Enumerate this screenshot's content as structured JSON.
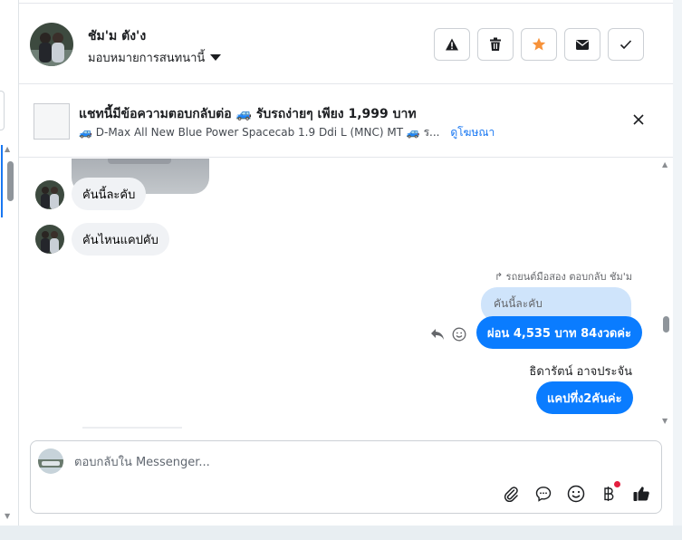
{
  "header": {
    "contact_name": "ชัม'ม ตัง'ง",
    "assign_label": "มอบหมายการสนทนานี้",
    "actions": [
      "spam-icon",
      "delete-icon",
      "star-icon",
      "mail-icon",
      "check-icon"
    ],
    "star_color": "#f7923a"
  },
  "ad": {
    "title": "แชทนี้มีข้อความตอบกลับต่อ 🚙 รับรถง่ายๆ เพียง 1,999 บาท",
    "subtitle": "🚙 D-Max All New Blue Power Spacecab 1.9 Ddi L (MNC) MT 🚙 ร...",
    "link": "ดูโฆษณา"
  },
  "messages": {
    "in_1": "คันนี้ละคับ",
    "in_2": "คันไหนแคปคับ",
    "reply_meta": "↱ รถยนต์มือสอง ตอบกลับ ชัม'ม",
    "quoted": "คันนี้ละคับ",
    "out_1": "ผ่อน 4,535 บาท 84งวดค่ะ",
    "sender": "ธิดารัตน์ อาจประจัน",
    "out_2": "แคปทึ่ง2คันค่ะ"
  },
  "composer": {
    "placeholder": "ตอบกลับใน Messenger...",
    "tools": [
      "attachment-icon",
      "saved-reply-icon",
      "emoji-icon",
      "baht-icon",
      "like-icon"
    ]
  },
  "colors": {
    "accent": "#0a7cff",
    "link": "#1877f2",
    "notification_dot": "#e41e3f"
  }
}
